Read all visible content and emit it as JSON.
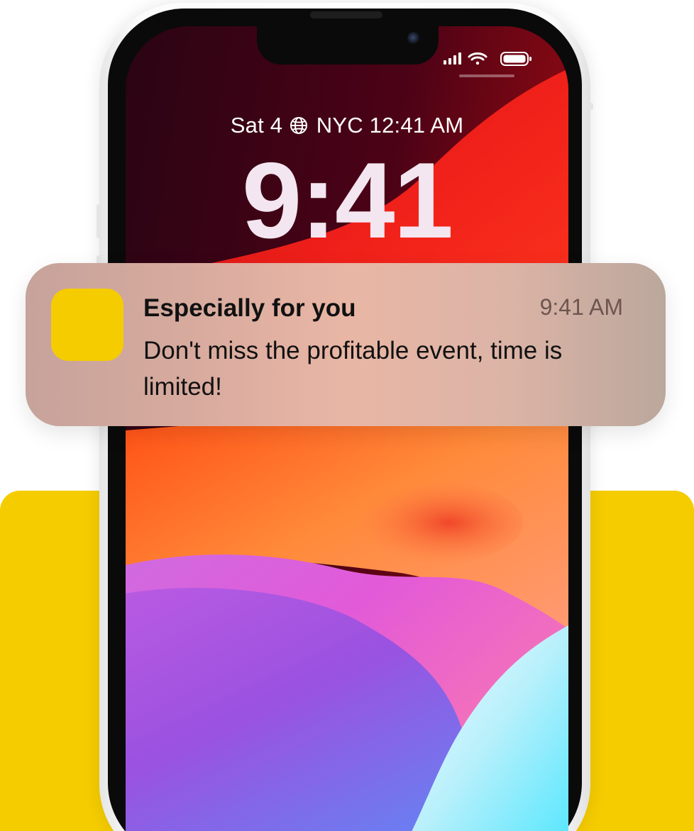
{
  "lock_screen": {
    "date_prefix": "Sat 4",
    "date_suffix": "NYC 12:41 AM",
    "world_clock_icon": "globe-icon",
    "time": "9:41"
  },
  "status_bar": {
    "icons": [
      "cellular-signal-icon",
      "wifi-icon",
      "battery-icon"
    ]
  },
  "notification": {
    "app_icon": "app-icon",
    "app_icon_color": "#f5cc00",
    "title": "Especially for you",
    "time": "9:41 AM",
    "body": "Don't miss the profitable event, time is limited!"
  },
  "colors": {
    "accent_yellow": "#f5cc00"
  }
}
